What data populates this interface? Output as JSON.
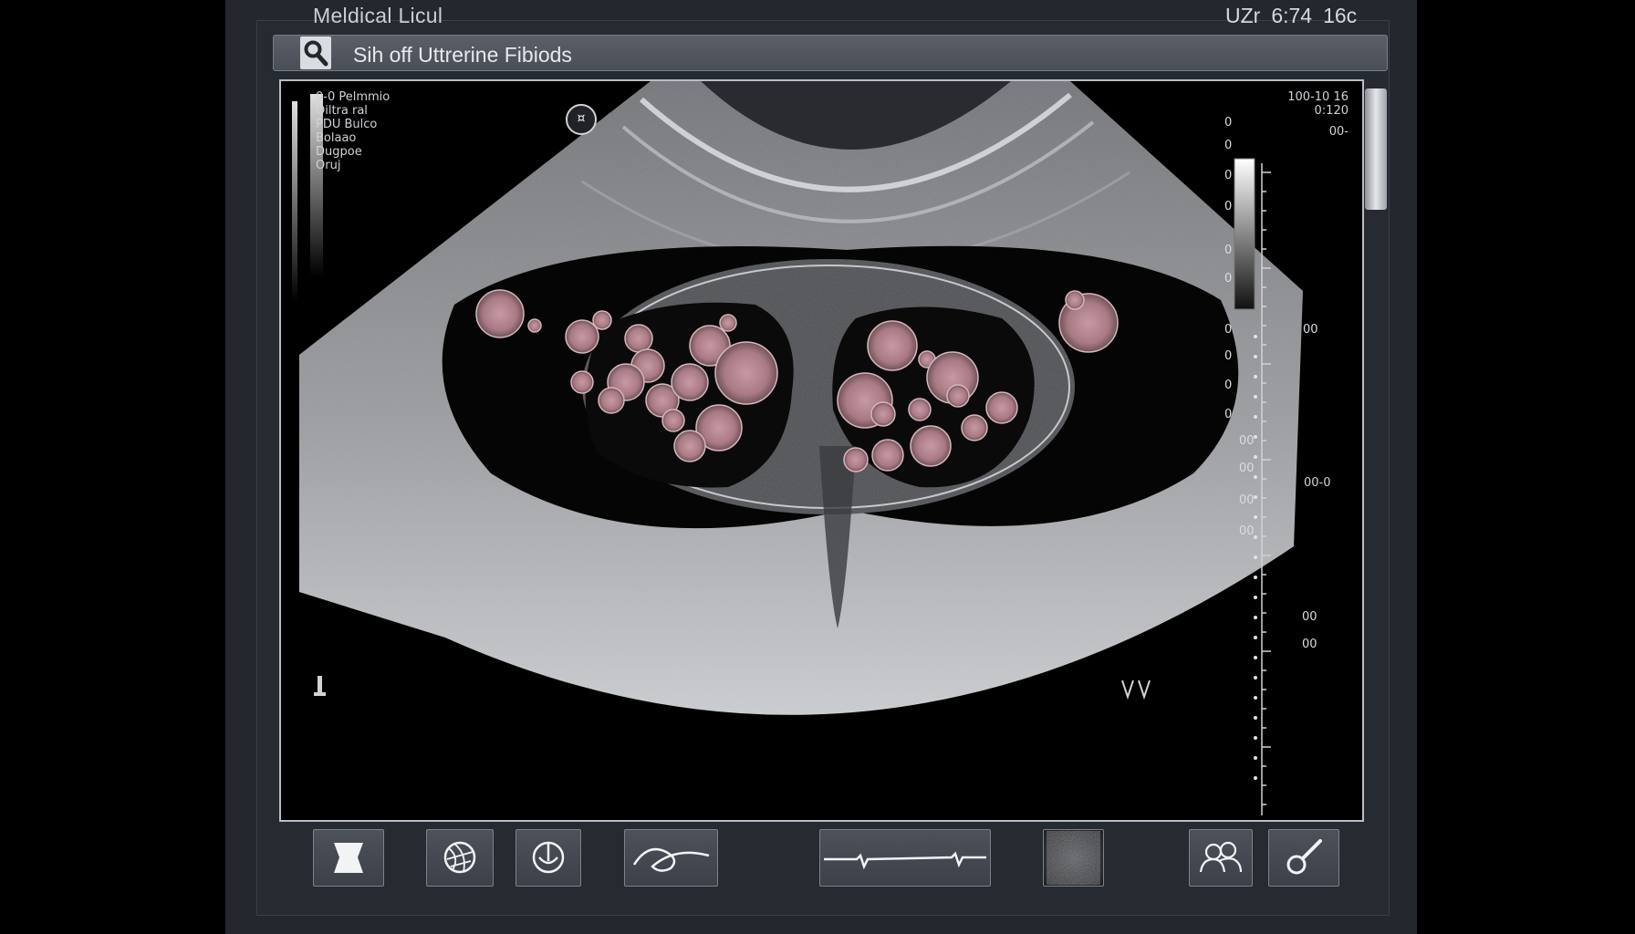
{
  "header": {
    "app_title": "Meldical Licul",
    "clock_a": "UZr",
    "clock_b": "6:74",
    "clock_c": "16c"
  },
  "search": {
    "query": "Sih off Uttrerine Fibiods"
  },
  "overlay": {
    "params": [
      "0-0 Pelmmio",
      "Oiltra ral",
      "PDU Bulco",
      "Bolaao",
      "Dugpoe",
      "Oruj"
    ],
    "date_line": "100-10 16",
    "time_line": "0:120",
    "gain_label": "00-",
    "orient_marker": "¤",
    "lower_marker": "00-0",
    "depth_left": [
      "0",
      "0",
      "0",
      "0",
      "0",
      "0",
      "0",
      "0",
      "0"
    ],
    "depth_labels_b": [
      "0",
      "00",
      "00",
      "00",
      "00"
    ],
    "right_small": [
      "00",
      "00",
      "00"
    ]
  },
  "toolbar": {
    "icons": [
      "bookmark-icon",
      "globe-icon",
      "compass-icon",
      "curve-icon",
      "waveform-icon",
      "texture-icon",
      "people-icon",
      "probe-icon"
    ]
  },
  "colors": {
    "bezel": "#23272e",
    "fibroid": "#b9868f",
    "viewport_border": "#b9bec5"
  }
}
